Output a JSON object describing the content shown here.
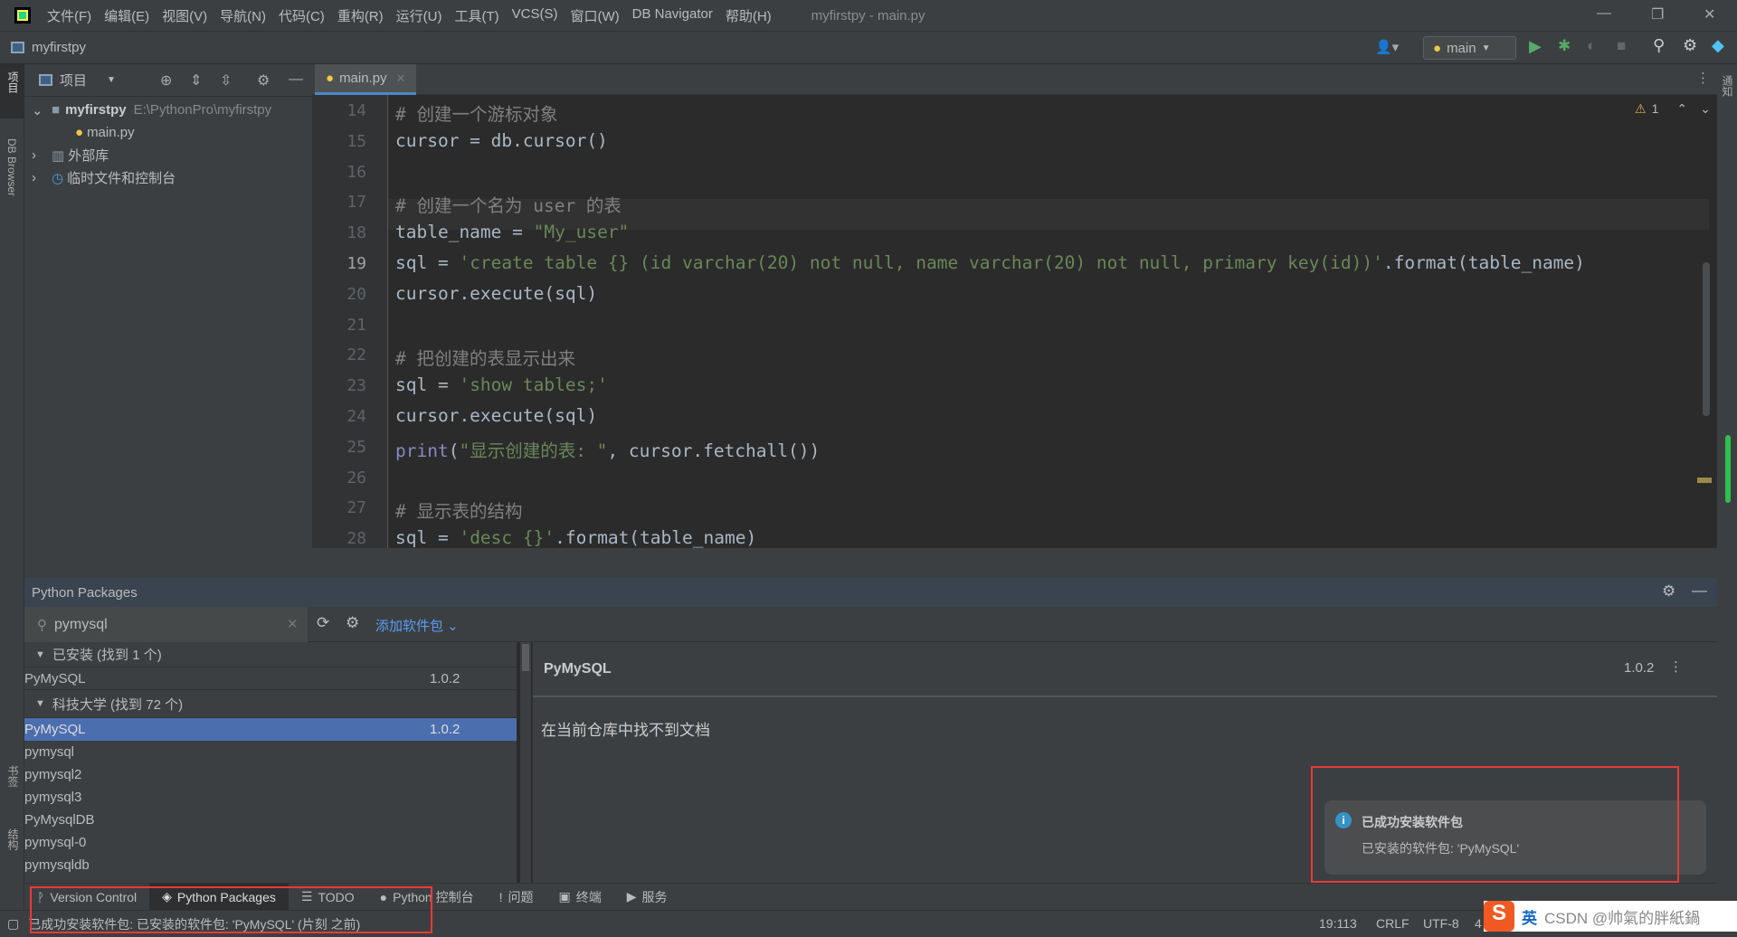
{
  "menubar": {
    "items": [
      "文件(F)",
      "编辑(E)",
      "视图(V)",
      "导航(N)",
      "代码(C)",
      "重构(R)",
      "运行(U)",
      "工具(T)",
      "VCS(S)",
      "窗口(W)",
      "DB Navigator",
      "帮助(H)"
    ],
    "title": "myfirstpy - main.py"
  },
  "navbar": {
    "project": "myfirstpy",
    "run_config": "main"
  },
  "left_strip": {
    "project": "项目",
    "db_browser": "DB Browser",
    "bookmarks": "书签",
    "structure": "结构"
  },
  "right_strip": {
    "notifications": "通知"
  },
  "project_panel": {
    "title": "项目",
    "root": {
      "name": "myfirstpy",
      "path": "E:\\PythonPro\\myfirstpy"
    },
    "file": "main.py",
    "external": "外部库",
    "scratch": "临时文件和控制台"
  },
  "editor": {
    "tab": "main.py",
    "warnings": "1",
    "current_line": 19,
    "lines": [
      {
        "n": "14",
        "parts": [
          [
            "c-com",
            "# 创建一个游标对象"
          ]
        ]
      },
      {
        "n": "15",
        "parts": [
          [
            "",
            "cursor = db.cursor()"
          ]
        ]
      },
      {
        "n": "16",
        "parts": []
      },
      {
        "n": "17",
        "parts": [
          [
            "c-com",
            "# 创建一个名为 user 的表"
          ]
        ]
      },
      {
        "n": "18",
        "parts": [
          [
            "",
            "table_name = "
          ],
          [
            "c-str",
            "\"My_user\""
          ]
        ]
      },
      {
        "n": "19",
        "parts": [
          [
            "",
            "sql = "
          ],
          [
            "c-str",
            "'create table {} (id varchar(20) not null, name varchar(20) not null, primary key(id))'"
          ],
          [
            "",
            ".format(table_name)"
          ]
        ]
      },
      {
        "n": "20",
        "parts": [
          [
            "",
            "cursor.execute(sql)"
          ]
        ]
      },
      {
        "n": "21",
        "parts": []
      },
      {
        "n": "22",
        "parts": [
          [
            "c-com",
            "# 把创建的表显示出来"
          ]
        ]
      },
      {
        "n": "23",
        "parts": [
          [
            "",
            "sql = "
          ],
          [
            "c-str",
            "'show tables;'"
          ]
        ]
      },
      {
        "n": "24",
        "parts": [
          [
            "",
            "cursor.execute(sql)"
          ]
        ]
      },
      {
        "n": "25",
        "parts": [
          [
            "c-fn",
            "print"
          ],
          [
            "",
            "("
          ],
          [
            "c-str",
            "\"显示创建的表: \""
          ],
          [
            "",
            ", cursor.fetchall())"
          ]
        ]
      },
      {
        "n": "26",
        "parts": []
      },
      {
        "n": "27",
        "parts": [
          [
            "c-com",
            "# 显示表的结构"
          ]
        ]
      },
      {
        "n": "28",
        "parts": [
          [
            "",
            "sql = "
          ],
          [
            "c-str",
            "'desc {}'"
          ],
          [
            "",
            ".format(table_name)"
          ]
        ]
      }
    ]
  },
  "packages": {
    "title": "Python Packages",
    "search_value": "pymysql",
    "add_label": "添加软件包",
    "installed_group": "已安装 (找到 1 个)",
    "installed": [
      {
        "name": "PyMySQL",
        "version": "1.0.2"
      }
    ],
    "repo_group": "科技大学 (找到 72 个)",
    "repo": [
      {
        "name": "PyMySQL",
        "version": "1.0.2",
        "selected": true
      },
      {
        "name": "pymysql"
      },
      {
        "name": "pymysql2"
      },
      {
        "name": "pymysql3"
      },
      {
        "name": "PyMysqlDB"
      },
      {
        "name": "pymysql-0"
      },
      {
        "name": "pymysqldb"
      }
    ],
    "detail": {
      "name": "PyMySQL",
      "version": "1.0.2",
      "message": "在当前仓库中找不到文档"
    }
  },
  "notification": {
    "title": "已成功安装软件包",
    "body": "已安装的软件包: 'PyMySQL'"
  },
  "tool_tabs": [
    "Version Control",
    "Python Packages",
    "TODO",
    "Python 控制台",
    "问题",
    "终端",
    "服务"
  ],
  "status": {
    "message": "已成功安装软件包: 已安装的软件包: 'PyMySQL' (片刻 之前)",
    "position": "19:113",
    "line_sep": "CRLF",
    "encoding": "UTF-8",
    "indent": "4"
  },
  "ime": {
    "lang": "英",
    "watermark": "CSDN @帅氣的胖紙鍋"
  },
  "colors": {
    "accent": "#4a88c7",
    "selection": "#4b6eaf",
    "highlight": "#e83a3a",
    "link": "#589df6"
  }
}
